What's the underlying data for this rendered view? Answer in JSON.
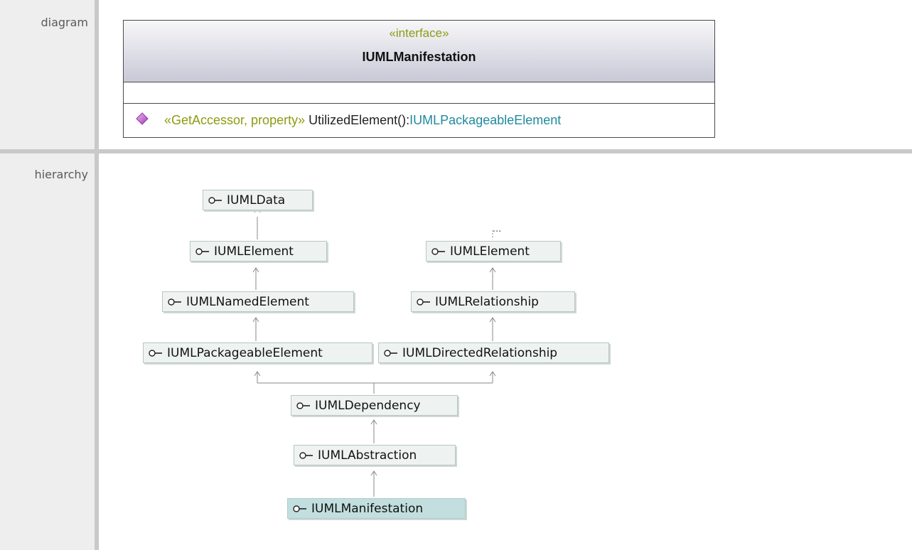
{
  "rows": {
    "diagram_label": "diagram",
    "hierarchy_label": "hierarchy"
  },
  "class_box": {
    "stereotype": "«interface»",
    "name": "IUMLManifestation",
    "operation": {
      "stereotype": "«GetAccessor, property»",
      "name": " UtilizedElement():",
      "return_type": "IUMLPackageableElement",
      "icon": "operation-diamond-icon"
    }
  },
  "hierarchy": {
    "ellipsis": "...",
    "nodes": {
      "iumldata": "IUMLData",
      "iumlelement_left": "IUMLElement",
      "iumlelement_right": "IUMLElement",
      "iumlnamedelement": "IUMLNamedElement",
      "iumlrelationship": "IUMLRelationship",
      "iumlpackageableelement": "IUMLPackageableElement",
      "iumldirectedrelationship": "IUMLDirectedRelationship",
      "iumldependency": "IUMLDependency",
      "iumlabstraction": "IUMLAbstraction",
      "iumlmanifestation": "IUMLManifestation"
    },
    "node_icon": "interface-lollipop-icon"
  },
  "colors": {
    "stereotype": "#8f9a12",
    "type_link": "#1f8a9e",
    "node_bg": "#eef3f2",
    "current_node_bg": "#c2dede",
    "separator": "#c9c9c9",
    "label_bg": "#eeeeee"
  }
}
